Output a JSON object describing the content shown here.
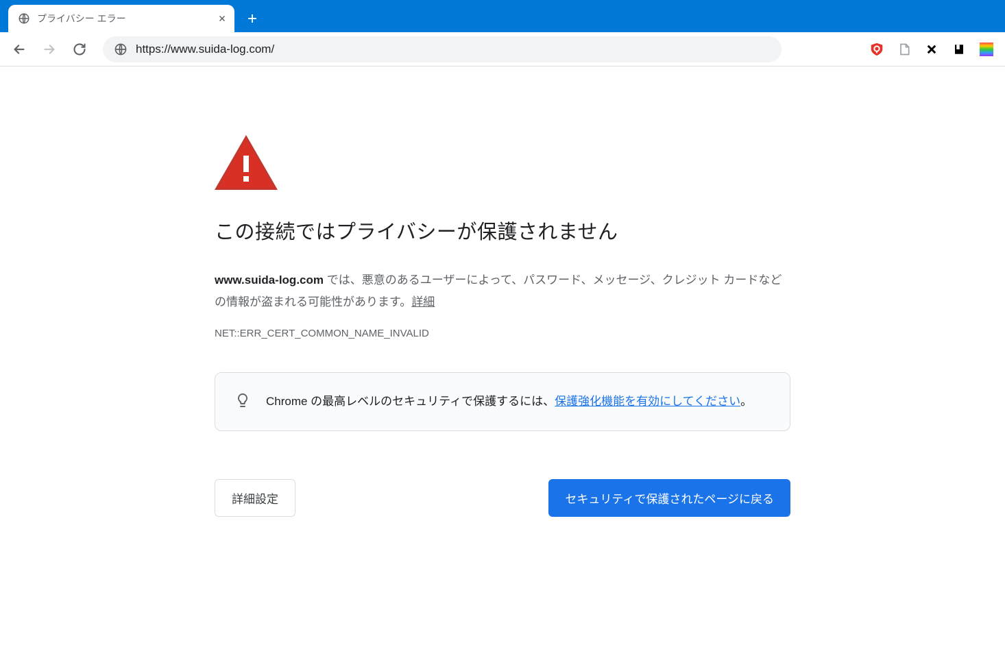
{
  "tab": {
    "title": "プライバシー エラー"
  },
  "omnibox": {
    "url": "https://www.suida-log.com/"
  },
  "error": {
    "title": "この接続ではプライバシーが保護されません",
    "host": "www.suida-log.com",
    "body_prefix": " では、悪意のあるユーザーによって、パスワード、メッセージ、クレジット カードなどの情報が盗まれる可能性があります。",
    "details_link": "詳細",
    "error_code": "NET::ERR_CERT_COMMON_NAME_INVALID",
    "suggestion_before": "Chrome の最高レベルのセキュリティで保護するには、",
    "suggestion_link": "保護強化機能を有効にしてください",
    "suggestion_after": "。",
    "advanced_button": "詳細設定",
    "back_button": "セキュリティで保護されたページに戻る"
  }
}
